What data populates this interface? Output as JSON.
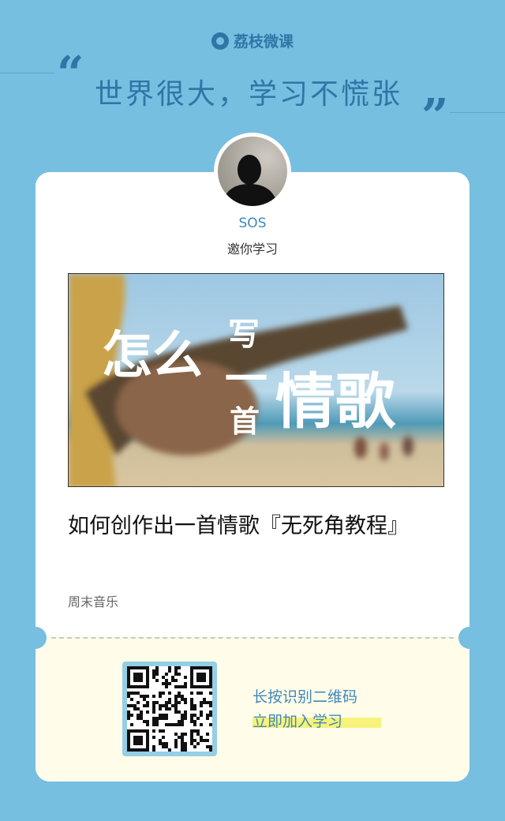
{
  "brand": {
    "name": "荔枝微课",
    "icon": "lizhi-logo-icon"
  },
  "slogan": {
    "open_quote": "“",
    "text": "世界很大，学习不慌张",
    "close_quote": "”"
  },
  "user": {
    "name": "SOS",
    "invite_text": "邀你学习"
  },
  "cover": {
    "text_1": "怎么",
    "text_2": "写",
    "text_3": "一",
    "text_4": "首",
    "text_5": "情歌"
  },
  "course": {
    "title": "如何创作出一首情歌『无死角教程』",
    "author": "周末音乐"
  },
  "qr": {
    "line1": "长按识别二维码",
    "line2": "立即加入学习"
  },
  "colors": {
    "background": "#76bfe0",
    "accent": "#2f76a6",
    "link": "#3f88b8",
    "card_bottom": "#fffdea",
    "highlight": "#f7f27a"
  }
}
